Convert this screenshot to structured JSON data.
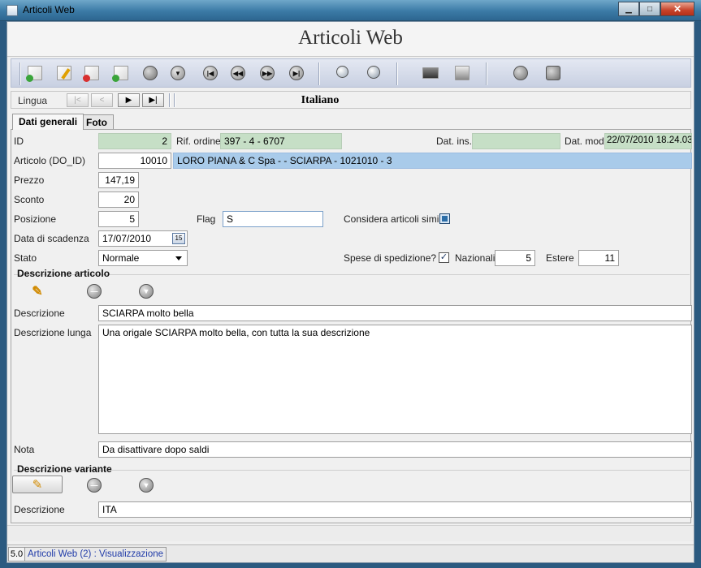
{
  "window": {
    "title": "Articoli Web",
    "min_glyph": "▁",
    "max_glyph": "□",
    "close_glyph": "✕"
  },
  "header": {
    "title": "Articoli Web"
  },
  "toolbar": {
    "icons": [
      "new-doc-icon",
      "edit-pencil-icon",
      "delete-doc-icon",
      "add-copy-icon",
      "cancel-icon",
      "save-down-icon",
      "first-record-icon",
      "previous-record-icon",
      "next-record-icon",
      "last-record-icon",
      "search-icon",
      "zoom-search-icon",
      "print-icon",
      "print-preview-icon",
      "refresh-icon",
      "exit-icon"
    ]
  },
  "lingua": {
    "label": "Lingua",
    "value": "Italiano",
    "first_glyph": "|<",
    "prev_glyph": "<",
    "next_glyph": "▶",
    "last_glyph": "▶|"
  },
  "tabs": [
    {
      "label": "Dati generali",
      "active": true
    },
    {
      "label": "Foto",
      "active": false
    }
  ],
  "form": {
    "id_label": "ID",
    "id_value": "2",
    "rif_ordine_label": "Rif. ordine",
    "rif_ordine_value": "397 - 4 - 6707",
    "dat_ins_label": "Dat. ins.",
    "dat_ins_value": "",
    "dat_mod_label": "Dat. mod.",
    "dat_mod_value": "22/07/2010 18.24.03",
    "articolo_label": "Articolo (DO_ID)",
    "articolo_id": "10010",
    "articolo_desc": "LORO PIANA & C Spa -  - SCIARPA - 1021010 - 3",
    "prezzo_label": "Prezzo",
    "prezzo_value": "147,19",
    "sconto_label": "Sconto",
    "sconto_value": "20",
    "posizione_label": "Posizione",
    "posizione_value": "5",
    "flag_label": "Flag",
    "flag_value": "S",
    "considera_label": "Considera articoli simili",
    "considera_checked": true,
    "scadenza_label": "Data di scadenza",
    "scadenza_value": "17/07/2010",
    "calendar_glyph": "15",
    "stato_label": "Stato",
    "stato_value": "Normale",
    "spese_label": "Spese di spedizione?",
    "spese_checked": true,
    "spese_check_glyph": "✓",
    "nazionali_label": "Nazionali",
    "nazionali_value": "5",
    "estere_label": "Estere",
    "estere_value": "11"
  },
  "descrizione_articolo": {
    "group_title": "Descrizione articolo",
    "descrizione_label": "Descrizione",
    "descrizione_value": "SCIARPA molto bella",
    "descrizione_lunga_label": "Descrizione lunga",
    "descrizione_lunga_value": "Una origale SCIARPA molto bella, con tutta la sua descrizione",
    "nota_label": "Nota",
    "nota_value": "Da disattivare dopo saldi"
  },
  "descrizione_variante": {
    "group_title": "Descrizione variante",
    "descrizione_label": "Descrizione",
    "descrizione_value": "ITA"
  },
  "statusbar": {
    "version": "5.0",
    "text": "Articoli Web (2) : Visualizzazione"
  }
}
